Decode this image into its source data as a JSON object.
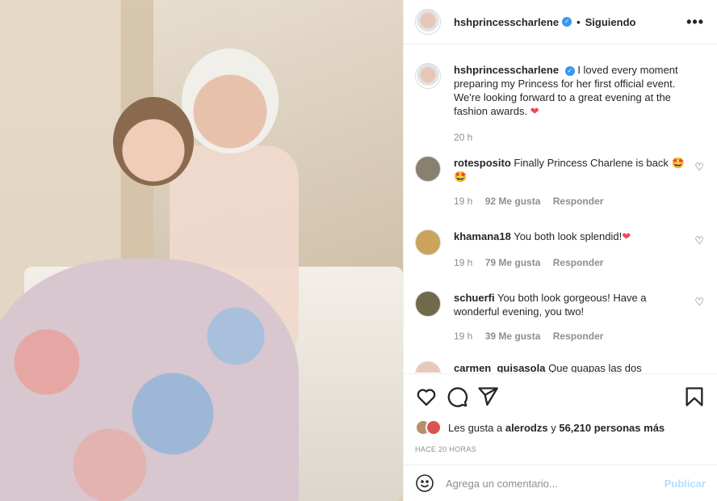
{
  "post": {
    "username": "hshprincesscharlene",
    "follow_status": "Siguiendo",
    "caption": "I loved every moment preparing my Princess for her first official event. We're looking forward to a great evening at the fashion awards.",
    "caption_emoji": "❤",
    "caption_time": "20 h"
  },
  "comments": [
    {
      "username": "rotesposito",
      "text": "Finally Princess Charlene is back 🤩🤩",
      "time": "19 h",
      "likes": "92 Me gusta",
      "reply": "Responder",
      "avatar_color": "#8a8070"
    },
    {
      "username": "khamana18",
      "text": "You both look splendid!",
      "emoji": "❤",
      "time": "19 h",
      "likes": "79 Me gusta",
      "reply": "Responder",
      "avatar_color": "#c9a45a"
    },
    {
      "username": "schuerfi",
      "text": "You both look gorgeous! Have a wonderful evening, you two!",
      "time": "19 h",
      "likes": "39 Me gusta",
      "reply": "Responder",
      "avatar_color": "#6f6a4a"
    },
    {
      "username": "carmen_quisasola",
      "text": "Que guapas las dos",
      "avatar_color": "#e9c8bd"
    }
  ],
  "likes_row": {
    "prefix": "Les gusta a",
    "user": "alerodzs",
    "connector": "y",
    "count": "56,210 personas más"
  },
  "time_ago": "HACE 20 HORAS",
  "comment_box": {
    "placeholder": "Agrega un comentario...",
    "publish_label": "Publicar"
  }
}
